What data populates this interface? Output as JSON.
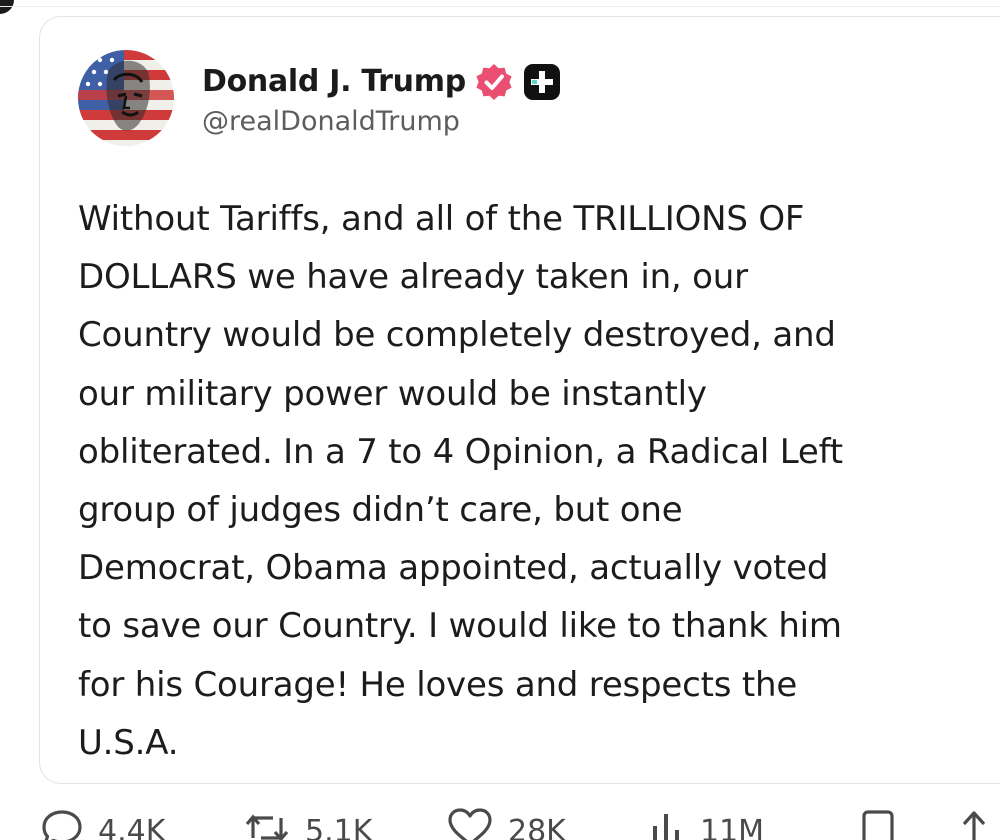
{
  "post": {
    "author": {
      "display_name": "Donald J. Trump",
      "handle": "@realDonaldTrump",
      "verified_icon": "verified-badge-icon",
      "plus_icon": "plus-badge-icon"
    },
    "text": "Without Tariffs, and all of the TRILLIONS OF\nDOLLARS we have already taken in, our\nCountry would be completely destroyed, and\nour military power would be instantly\nobliterated. In a 7 to 4 Opinion, a Radical Left\ngroup of judges didn’t care, but one\nDemocrat, Obama appointed, actually voted\nto save our Country. I would like to thank him\nfor his Courage! He loves and respects the\nU.S.A."
  },
  "actions": {
    "reply": {
      "icon": "reply-icon",
      "count": "4.4K"
    },
    "retruth": {
      "icon": "retruth-icon",
      "count": "5.1K"
    },
    "like": {
      "icon": "heart-icon",
      "count": "28K"
    },
    "views": {
      "icon": "views-icon",
      "count": "11M"
    },
    "bookmark": {
      "icon": "bookmark-icon"
    },
    "share": {
      "icon": "share-icon"
    }
  },
  "colors": {
    "verified_badge": "#ea4f72",
    "plus_badge": "#111111",
    "text": "#1c1c1c",
    "handle": "#5d5d5d",
    "card_border": "#e3e3e3"
  }
}
